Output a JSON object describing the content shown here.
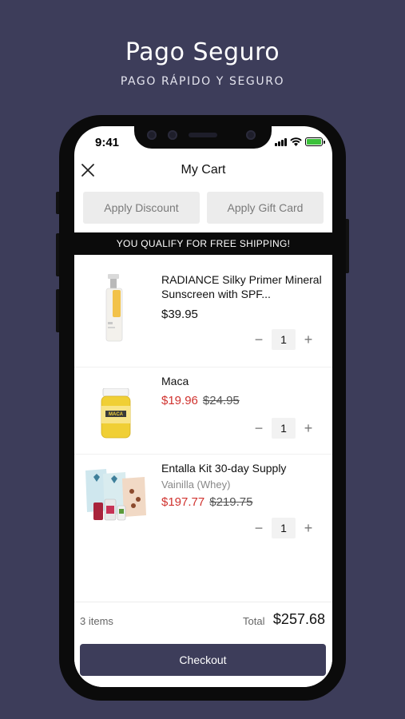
{
  "hero": {
    "title": "Pago Seguro",
    "subtitle": "PAGO RÁPIDO Y SEGURO"
  },
  "status_bar": {
    "time": "9:41",
    "icons": [
      "signal-icon",
      "wifi-icon",
      "battery-icon"
    ],
    "battery_color": "#3cc13b"
  },
  "header": {
    "title": "My Cart",
    "close_icon": "close-icon"
  },
  "actions": {
    "apply_discount": "Apply Discount",
    "apply_gift_card": "Apply Gift Card"
  },
  "banner": {
    "text": "YOU QUALIFY FOR FREE SHIPPING!"
  },
  "items": [
    {
      "name": "RADIANCE Silky Primer Mineral Sunscreen with SPF...",
      "price": "$39.95",
      "quantity": "1"
    },
    {
      "name": "Maca",
      "price": "$19.96",
      "original_price": "$24.95",
      "quantity": "1"
    },
    {
      "name": "Entalla Kit 30-day Supply",
      "variant": "Vainilla (Whey)",
      "price": "$197.77",
      "original_price": "$219.75",
      "quantity": "1"
    }
  ],
  "qty_controls": {
    "minus": "−",
    "plus": "+"
  },
  "summary": {
    "items_count": "3 items",
    "total_label": "Total",
    "total_value": "$257.68"
  },
  "checkout": {
    "label": "Checkout"
  },
  "colors": {
    "background": "#3d3d5a",
    "sale_price": "#d0332f",
    "banner": "#0b0b0b"
  }
}
